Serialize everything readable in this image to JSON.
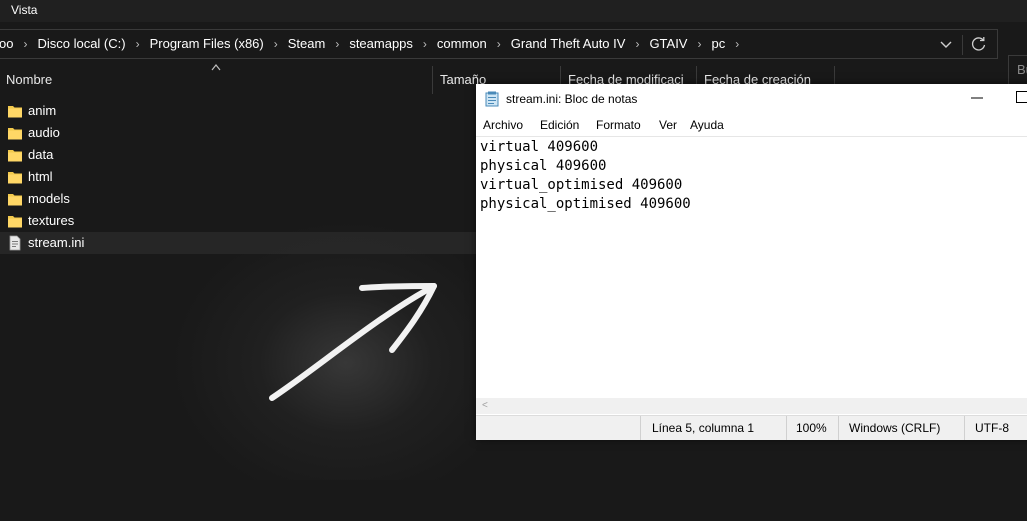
{
  "explorer": {
    "menu": {
      "view_label": "Vista"
    },
    "breadcrumb": [
      "oo",
      "Disco local (C:)",
      "Program Files (x86)",
      "Steam",
      "steamapps",
      "common",
      "Grand Theft Auto IV",
      "GTAIV",
      "pc"
    ],
    "search_placeholder": "Bu",
    "columns": {
      "name": "Nombre",
      "size": "Tamaño",
      "modified": "Fecha de modificaci",
      "created": "Fecha de creación"
    },
    "files": [
      {
        "name": "anim",
        "type": "folder-icon"
      },
      {
        "name": "audio",
        "type": "folder-icon"
      },
      {
        "name": "data",
        "type": "folder-icon"
      },
      {
        "name": "html",
        "type": "folder-icon"
      },
      {
        "name": "models",
        "type": "folder-icon"
      },
      {
        "name": "textures",
        "type": "folder-icon"
      },
      {
        "name": "stream.ini",
        "type": "ini-file-icon",
        "selected": true
      }
    ],
    "colors": {
      "background": "#191919",
      "folder": "#f2c94c"
    }
  },
  "notepad": {
    "title": "stream.ini: Bloc de notas",
    "menu": [
      "Archivo",
      "Edición",
      "Formato",
      "Ver",
      "Ayuda"
    ],
    "content_lines": [
      "virtual 409600",
      "physical 409600",
      "virtual_optimised 409600",
      "physical_optimised 409600"
    ],
    "status": {
      "position": "Línea 5, columna 1",
      "zoom": "100%",
      "line_ending": "Windows (CRLF)",
      "encoding": "UTF-8"
    }
  }
}
